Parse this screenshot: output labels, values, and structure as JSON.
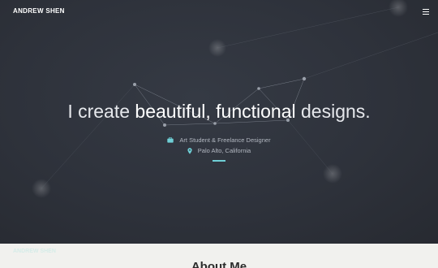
{
  "header": {
    "brand": "ANDREW SHEN",
    "menu_icon": "hamburger-menu-icon"
  },
  "hero": {
    "headline_prefix": "I create ",
    "headline_emphasis": "beautiful, functional",
    "headline_suffix": " designs.",
    "role": "Art Student & Freelance Designer",
    "role_icon": "briefcase-icon",
    "location": "Palo Alto, California",
    "location_icon": "map-pin-icon"
  },
  "about": {
    "brand": "ANDREW SHEN",
    "title": "About Me"
  },
  "colors": {
    "hero_background": "#2e323b",
    "accent": "#6fcfd6",
    "section_background": "#f1f1ee"
  }
}
